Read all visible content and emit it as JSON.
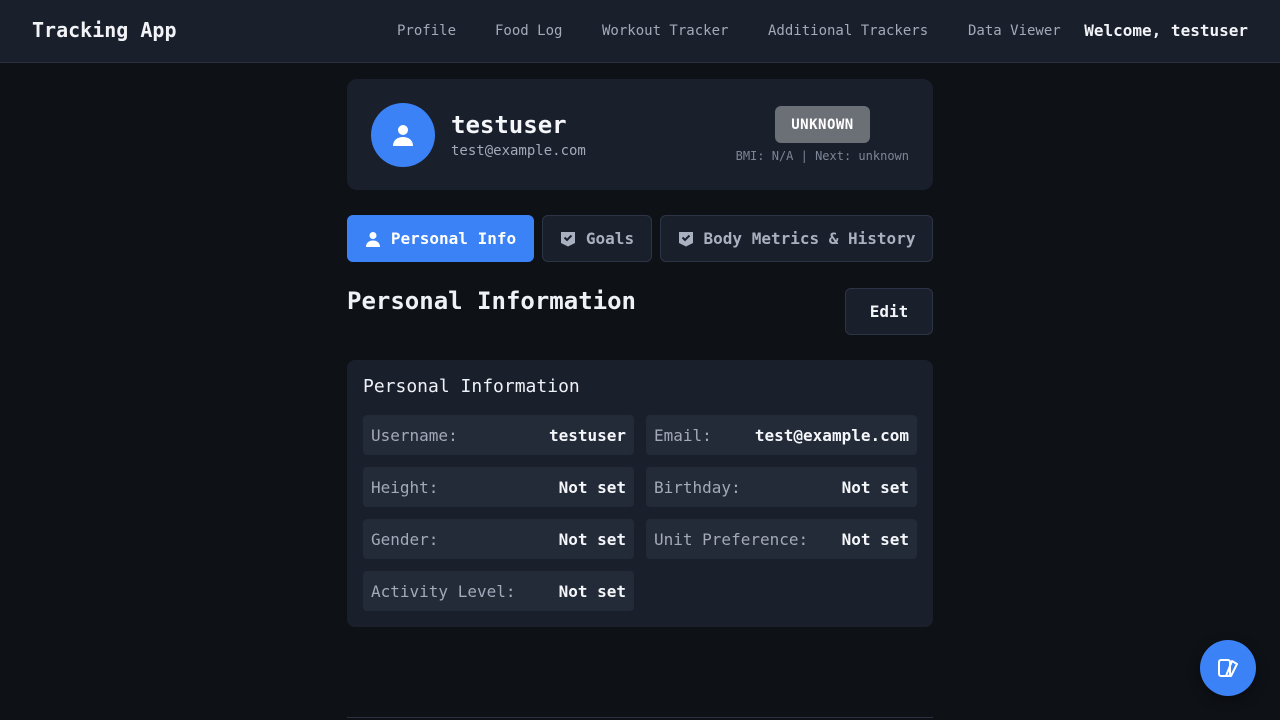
{
  "app": {
    "title": "Tracking App",
    "welcome": "Welcome, testuser"
  },
  "nav": {
    "items": [
      "Profile",
      "Food Log",
      "Workout Tracker",
      "Additional Trackers",
      "Data Viewer"
    ]
  },
  "profile": {
    "username": "testuser",
    "email": "test@example.com",
    "status_badge": "UNKNOWN",
    "bmi_line": "BMI: N/A | Next: unknown",
    "avatar_icon": "user-icon"
  },
  "tabs": [
    {
      "label": "Personal Info",
      "icon": "user-icon",
      "active": true
    },
    {
      "label": "Goals",
      "icon": "badge-icon",
      "active": false
    },
    {
      "label": "Body Metrics & History",
      "icon": "badge-icon",
      "active": false
    }
  ],
  "section": {
    "title": "Personal Information",
    "edit_label": "Edit"
  },
  "info_card": {
    "title": "Personal Information",
    "fields": [
      {
        "label": "Username:",
        "value": "testuser"
      },
      {
        "label": "Email:",
        "value": "test@example.com"
      },
      {
        "label": "Height:",
        "value": "Not set"
      },
      {
        "label": "Birthday:",
        "value": "Not set"
      },
      {
        "label": "Gender:",
        "value": "Not set"
      },
      {
        "label": "Unit Preference:",
        "value": "Not set"
      },
      {
        "label": "Activity Level:",
        "value": "Not set"
      }
    ]
  },
  "fab": {
    "icon": "theme-icon"
  },
  "colors": {
    "accent": "#3b82f6",
    "badge_unknown": "#6b6f76",
    "background": "#0e1116",
    "card": "#1a1f2c"
  }
}
